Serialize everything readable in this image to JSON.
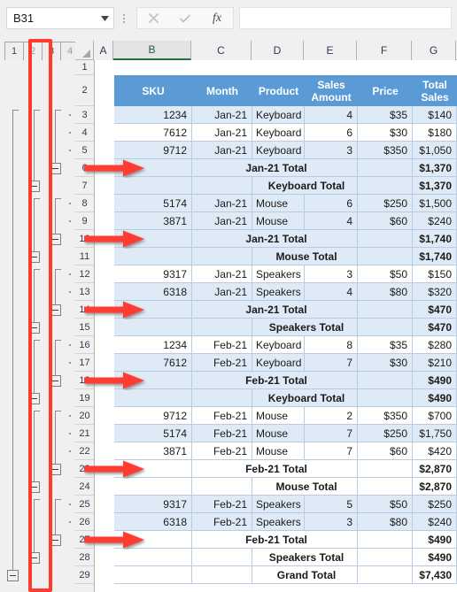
{
  "app": {
    "name_box_value": "B31",
    "formula_value": "",
    "cancel_icon": "cancel-x-icon",
    "confirm_icon": "check-icon",
    "fx_label": "fx"
  },
  "outline": {
    "levels": [
      "1",
      "2",
      "3",
      "4"
    ],
    "selected_level": "3",
    "highlight_color": "#FF3B30"
  },
  "columns": [
    {
      "letter": "A",
      "selected": false
    },
    {
      "letter": "B",
      "selected": true
    },
    {
      "letter": "C",
      "selected": false
    },
    {
      "letter": "D",
      "selected": false
    },
    {
      "letter": "E",
      "selected": false
    },
    {
      "letter": "F",
      "selected": false
    },
    {
      "letter": "G",
      "selected": false
    }
  ],
  "table_header": {
    "sku": "SKU",
    "month": "Month",
    "product": "Product",
    "sales_amount": "Sales\nAmount",
    "sales_amount_l1": "Sales",
    "sales_amount_l2": "Amount",
    "price": "Price",
    "total_sales_l1": "Total",
    "total_sales_l2": "Sales"
  },
  "colors": {
    "header_blue": "#5B9BD5",
    "band_blue": "#DEEAF6",
    "grid_border": "#B8CCE4",
    "accent_red": "#FF3B30",
    "tab_green": "#217346"
  },
  "rows": [
    {
      "n": "1",
      "type": "empty"
    },
    {
      "n": "2",
      "type": "header"
    },
    {
      "n": "3",
      "type": "data",
      "band": true,
      "sku": "1234",
      "month": "Jan-21",
      "product": "Keyboard",
      "amount": "4",
      "price": "$35",
      "total": "$140"
    },
    {
      "n": "4",
      "type": "data",
      "band": false,
      "sku": "7612",
      "month": "Jan-21",
      "product": "Keyboard",
      "amount": "6",
      "price": "$30",
      "total": "$180"
    },
    {
      "n": "5",
      "type": "data",
      "band": true,
      "sku": "9712",
      "month": "Jan-21",
      "product": "Keyboard",
      "amount": "3",
      "price": "$350",
      "total": "$1,050"
    },
    {
      "n": "6",
      "type": "subtotal",
      "band": true,
      "label": "Jan-21 Total",
      "label_col": "C",
      "total": "$1,370",
      "arrow": true
    },
    {
      "n": "7",
      "type": "subtotal",
      "band": true,
      "label": "Keyboard Total",
      "label_col": "D",
      "total": "$1,370"
    },
    {
      "n": "8",
      "type": "data",
      "band": true,
      "sku": "5174",
      "month": "Jan-21",
      "product": "Mouse",
      "amount": "6",
      "price": "$250",
      "total": "$1,500"
    },
    {
      "n": "9",
      "type": "data",
      "band": true,
      "sku": "3871",
      "month": "Jan-21",
      "product": "Mouse",
      "amount": "4",
      "price": "$60",
      "total": "$240"
    },
    {
      "n": "10",
      "type": "subtotal",
      "band": true,
      "label": "Jan-21 Total",
      "label_col": "C",
      "total": "$1,740",
      "arrow": true
    },
    {
      "n": "11",
      "type": "subtotal",
      "band": true,
      "label": "Mouse Total",
      "label_col": "D",
      "total": "$1,740"
    },
    {
      "n": "12",
      "type": "data",
      "band": false,
      "sku": "9317",
      "month": "Jan-21",
      "product": "Speakers",
      "amount": "3",
      "price": "$50",
      "total": "$150"
    },
    {
      "n": "13",
      "type": "data",
      "band": true,
      "sku": "6318",
      "month": "Jan-21",
      "product": "Speakers",
      "amount": "4",
      "price": "$80",
      "total": "$320"
    },
    {
      "n": "14",
      "type": "subtotal",
      "band": true,
      "label": "Jan-21 Total",
      "label_col": "C",
      "total": "$470",
      "arrow": true
    },
    {
      "n": "15",
      "type": "subtotal",
      "band": true,
      "label": "Speakers Total",
      "label_col": "D",
      "total": "$470"
    },
    {
      "n": "16",
      "type": "data",
      "band": false,
      "sku": "1234",
      "month": "Feb-21",
      "product": "Keyboard",
      "amount": "8",
      "price": "$35",
      "total": "$280"
    },
    {
      "n": "17",
      "type": "data",
      "band": true,
      "sku": "7612",
      "month": "Feb-21",
      "product": "Keyboard",
      "amount": "7",
      "price": "$30",
      "total": "$210"
    },
    {
      "n": "18",
      "type": "subtotal",
      "band": true,
      "label": "Feb-21 Total",
      "label_col": "C",
      "total": "$490",
      "arrow": true
    },
    {
      "n": "19",
      "type": "subtotal",
      "band": true,
      "label": "Keyboard Total",
      "label_col": "D",
      "total": "$490"
    },
    {
      "n": "20",
      "type": "data",
      "band": false,
      "sku": "9712",
      "month": "Feb-21",
      "product": "Mouse",
      "amount": "2",
      "price": "$350",
      "total": "$700"
    },
    {
      "n": "21",
      "type": "data",
      "band": true,
      "sku": "5174",
      "month": "Feb-21",
      "product": "Mouse",
      "amount": "7",
      "price": "$250",
      "total": "$1,750"
    },
    {
      "n": "22",
      "type": "data",
      "band": false,
      "sku": "3871",
      "month": "Feb-21",
      "product": "Mouse",
      "amount": "7",
      "price": "$60",
      "total": "$420"
    },
    {
      "n": "23",
      "type": "subtotal",
      "band": false,
      "label": "Feb-21 Total",
      "label_col": "C",
      "total": "$2,870",
      "arrow": true
    },
    {
      "n": "24",
      "type": "subtotal",
      "band": false,
      "label": "Mouse Total",
      "label_col": "D",
      "total": "$2,870"
    },
    {
      "n": "25",
      "type": "data",
      "band": true,
      "sku": "9317",
      "month": "Feb-21",
      "product": "Speakers",
      "amount": "5",
      "price": "$50",
      "total": "$250"
    },
    {
      "n": "26",
      "type": "data",
      "band": true,
      "sku": "6318",
      "month": "Feb-21",
      "product": "Speakers",
      "amount": "3",
      "price": "$80",
      "total": "$240"
    },
    {
      "n": "27",
      "type": "subtotal",
      "band": false,
      "label": "Feb-21 Total",
      "label_col": "C",
      "total": "$490",
      "arrow": true
    },
    {
      "n": "28",
      "type": "subtotal",
      "band": false,
      "label": "Speakers Total",
      "label_col": "D",
      "total": "$490"
    },
    {
      "n": "29",
      "type": "subtotal",
      "band": false,
      "label": "Grand Total",
      "label_col": "D",
      "total": "$7,430"
    }
  ]
}
